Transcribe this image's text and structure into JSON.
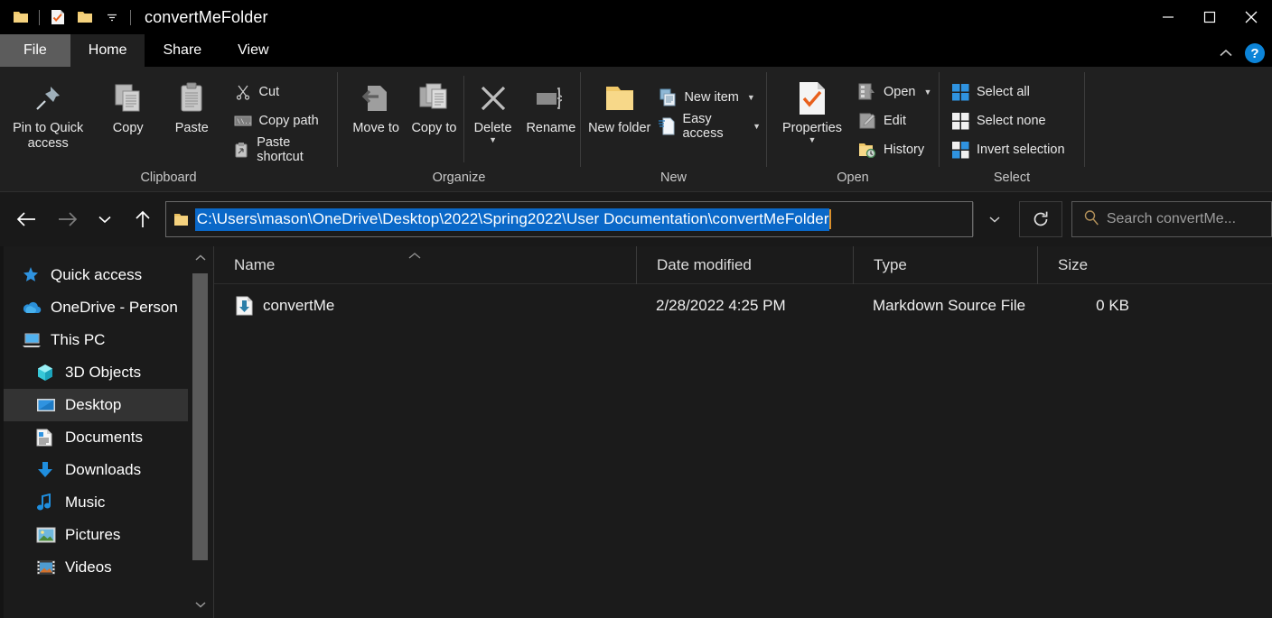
{
  "window": {
    "title": "convertMeFolder",
    "quick_access_icons": [
      "folder-icon",
      "properties-check-icon",
      "new-folder-icon",
      "customize-qat-dropdown-icon"
    ],
    "minimize_label": "Minimize",
    "maximize_label": "Maximize",
    "close_label": "Close"
  },
  "tabs": [
    {
      "label": "File",
      "state": "file"
    },
    {
      "label": "Home",
      "state": "active"
    },
    {
      "label": "Share",
      "state": "normal"
    },
    {
      "label": "View",
      "state": "normal"
    }
  ],
  "ribbon_controls": {
    "collapse_icon": "chevron-up-icon",
    "help_label": "?"
  },
  "ribbon": {
    "groups": [
      {
        "title": "Clipboard",
        "big": [
          {
            "label": "Pin to Quick access",
            "icon": "pin-icon"
          },
          {
            "label": "Copy",
            "icon": "copy-icon"
          },
          {
            "label": "Paste",
            "icon": "paste-icon"
          }
        ],
        "small": [
          {
            "label": "Cut",
            "icon": "scissors-icon"
          },
          {
            "label": "Copy path",
            "icon": "copy-path-icon"
          },
          {
            "label": "Paste shortcut",
            "icon": "paste-shortcut-icon"
          }
        ]
      },
      {
        "title": "Organize",
        "big": [
          {
            "label": "Move to",
            "icon": "move-to-icon",
            "dropdown": true
          },
          {
            "label": "Copy to",
            "icon": "copy-to-icon",
            "dropdown": true
          },
          {
            "label": "Delete",
            "icon": "delete-x-icon",
            "dropdown_below": true
          },
          {
            "label": "Rename",
            "icon": "rename-icon"
          }
        ],
        "small": []
      },
      {
        "title": "New",
        "big": [
          {
            "label": "New folder",
            "icon": "new-folder-icon"
          }
        ],
        "small": [
          {
            "label": "New item",
            "icon": "new-item-icon",
            "dropdown": true
          },
          {
            "label": "Easy access",
            "icon": "easy-access-icon",
            "dropdown": true
          }
        ]
      },
      {
        "title": "Open",
        "big": [
          {
            "label": "Properties",
            "icon": "properties-check-icon",
            "dropdown_below": true
          }
        ],
        "small": [
          {
            "label": "Open",
            "icon": "open-icon",
            "dropdown": true
          },
          {
            "label": "Edit",
            "icon": "edit-icon"
          },
          {
            "label": "History",
            "icon": "history-icon"
          }
        ]
      },
      {
        "title": "Select",
        "big": [],
        "small": [
          {
            "label": "Select all",
            "icon": "select-all-icon"
          },
          {
            "label": "Select none",
            "icon": "select-none-icon"
          },
          {
            "label": "Invert selection",
            "icon": "invert-selection-icon"
          }
        ]
      }
    ]
  },
  "address": {
    "back_icon": "arrow-left-icon",
    "forward_icon": "arrow-right-icon",
    "recent_icon": "chevron-down-icon",
    "up_icon": "arrow-up-icon",
    "folder_icon": "folder-icon",
    "path": "C:\\Users\\mason\\OneDrive\\Desktop\\2022\\Spring2022\\User Documentation\\convertMeFolder",
    "path_selected": true,
    "dropdown_icon": "chevron-down-icon",
    "refresh_icon": "refresh-icon",
    "selection_color": "#0a68c8",
    "caret_color": "#d98f2b"
  },
  "search": {
    "icon": "search-icon",
    "placeholder": "Search convertMe...",
    "value": ""
  },
  "nav_pane": {
    "items": [
      {
        "label": "Quick access",
        "icon": "star-pin-icon",
        "level": 1,
        "selected": false
      },
      {
        "label": "OneDrive - Person",
        "icon": "onedrive-cloud-icon",
        "level": 1,
        "selected": false
      },
      {
        "label": "This PC",
        "icon": "this-pc-icon",
        "level": 1,
        "selected": false
      },
      {
        "label": "3D Objects",
        "icon": "3d-objects-icon",
        "level": 2,
        "selected": false
      },
      {
        "label": "Desktop",
        "icon": "desktop-icon",
        "level": 2,
        "selected": true
      },
      {
        "label": "Documents",
        "icon": "documents-icon",
        "level": 2,
        "selected": false
      },
      {
        "label": "Downloads",
        "icon": "downloads-icon",
        "level": 2,
        "selected": false
      },
      {
        "label": "Music",
        "icon": "music-icon",
        "level": 2,
        "selected": false
      },
      {
        "label": "Pictures",
        "icon": "pictures-icon",
        "level": 2,
        "selected": false
      },
      {
        "label": "Videos",
        "icon": "videos-icon",
        "level": 2,
        "selected": false
      }
    ],
    "scrollbar": {
      "up_icon": "chevron-up-icon",
      "down_icon": "chevron-down-icon"
    }
  },
  "file_list": {
    "columns": [
      {
        "label": "Name",
        "sorted": true,
        "sort_icon": "sort-ascending-icon"
      },
      {
        "label": "Date modified",
        "sorted": false
      },
      {
        "label": "Type",
        "sorted": false
      },
      {
        "label": "Size",
        "sorted": false
      }
    ],
    "rows": [
      {
        "name": "convertMe",
        "icon": "markdown-file-icon",
        "date_modified": "2/28/2022 4:25 PM",
        "type": "Markdown Source File",
        "size": "0 KB"
      }
    ]
  },
  "colors": {
    "titlebar_bg": "#000000",
    "ribbon_bg": "#202020",
    "body_bg": "#1b1b1b",
    "accent_blue": "#0c84d8",
    "selection_blue": "#0a68c8",
    "text": "#ffffff",
    "folder_yellow": "#f5cf6b"
  }
}
